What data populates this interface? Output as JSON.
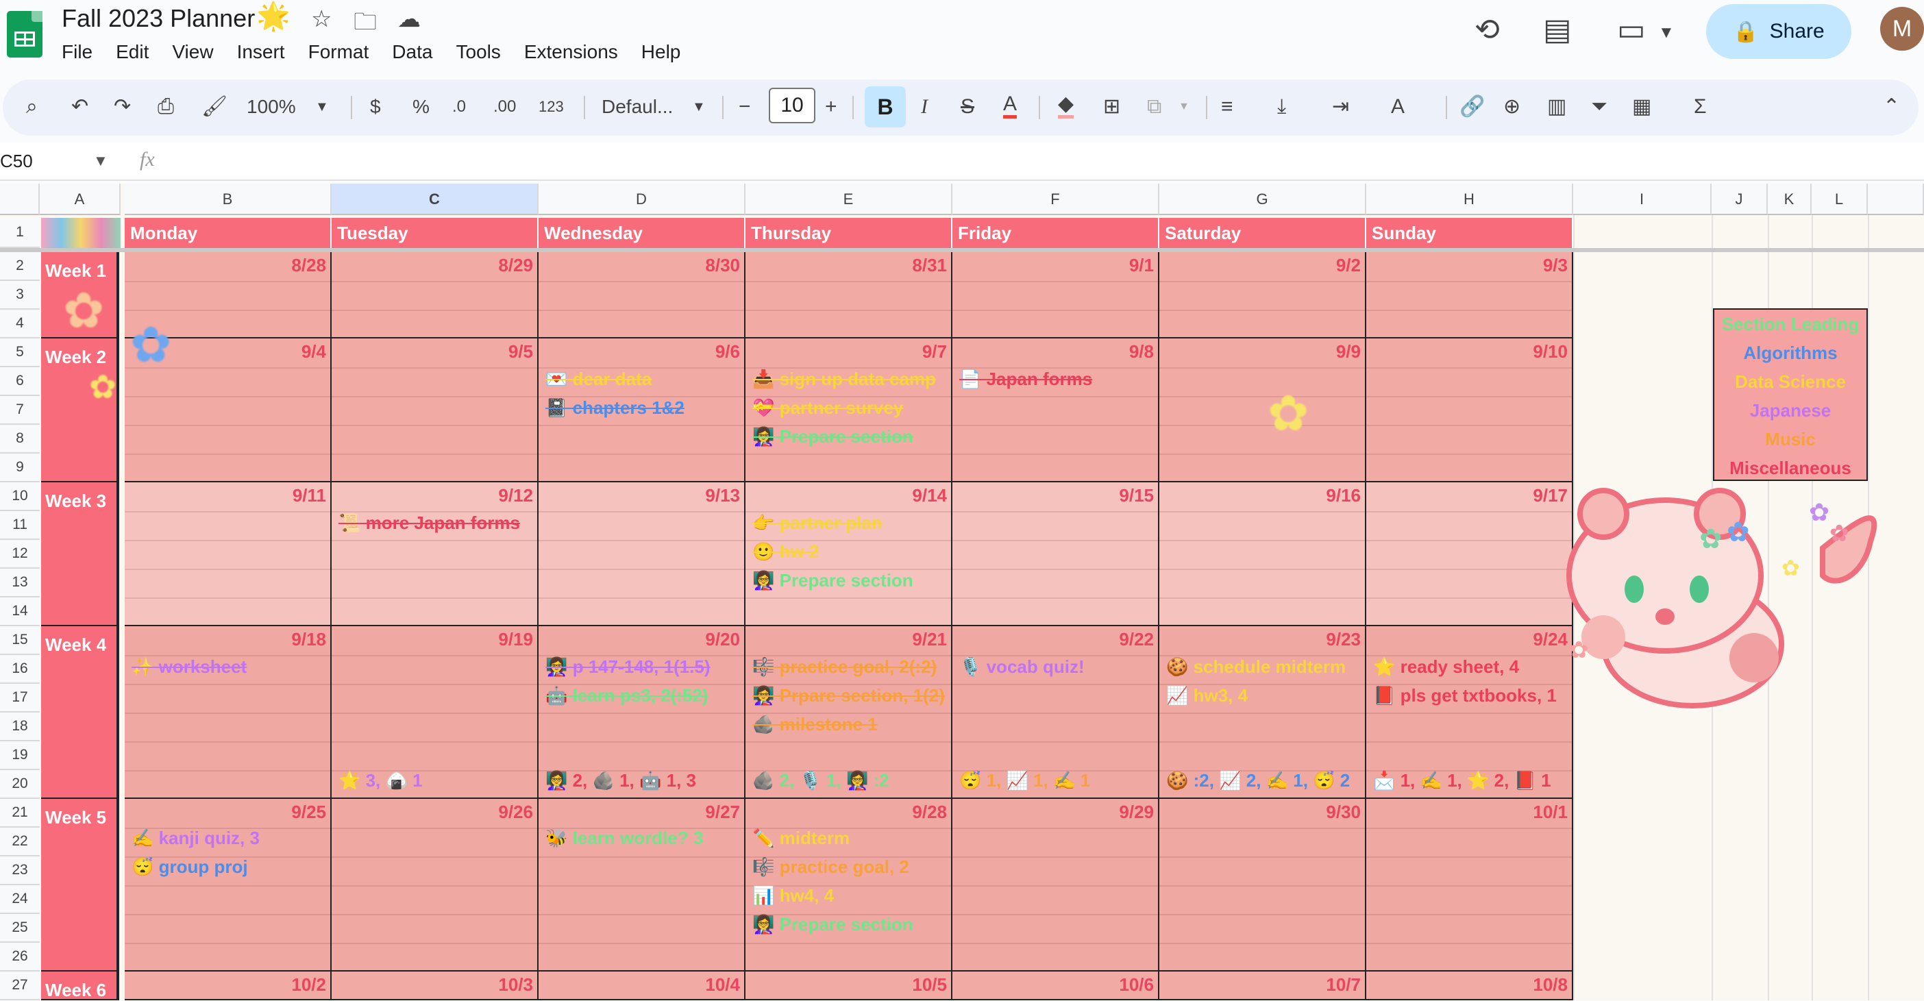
{
  "header": {
    "title": "Fall 2023 Planner",
    "title_emoji": "🌟",
    "menu": [
      "File",
      "Edit",
      "View",
      "Insert",
      "Format",
      "Data",
      "Tools",
      "Extensions",
      "Help"
    ],
    "share_label": "Share",
    "avatar_initial": "M"
  },
  "toolbar": {
    "zoom": "100%",
    "currency": "$",
    "percent": "%",
    "dec_less": ".0",
    "dec_more": ".00",
    "number_format": "123",
    "font": "Defaul...",
    "font_size": "10",
    "bold": "B",
    "italic": "I"
  },
  "formula_bar": {
    "cell_ref": "C50",
    "fx": "fx"
  },
  "columns": [
    "A",
    "B",
    "C",
    "D",
    "E",
    "F",
    "G",
    "H",
    "I",
    "J",
    "K",
    "L"
  ],
  "rows": [
    "1",
    "2",
    "3",
    "4",
    "5",
    "6",
    "7",
    "8",
    "9",
    "10",
    "11",
    "12",
    "13",
    "14",
    "15",
    "16",
    "17",
    "18",
    "19",
    "20",
    "21",
    "22",
    "23",
    "24",
    "25",
    "26",
    "27"
  ],
  "days": [
    "Monday",
    "Tuesday",
    "Wednesday",
    "Thursday",
    "Friday",
    "Saturday",
    "Sunday"
  ],
  "weeks": [
    {
      "label": "Week 1",
      "dates": [
        "8/28",
        "8/29",
        "8/30",
        "8/31",
        "9/1",
        "9/2",
        "9/3"
      ]
    },
    {
      "label": "Week 2",
      "dates": [
        "9/4",
        "9/5",
        "9/6",
        "9/7",
        "9/8",
        "9/9",
        "9/10"
      ]
    },
    {
      "label": "Week 3",
      "dates": [
        "9/11",
        "9/12",
        "9/13",
        "9/14",
        "9/15",
        "9/16",
        "9/17"
      ]
    },
    {
      "label": "Week 4",
      "dates": [
        "9/18",
        "9/19",
        "9/20",
        "9/21",
        "9/22",
        "9/23",
        "9/24"
      ]
    },
    {
      "label": "Week 5",
      "dates": [
        "9/25",
        "9/26",
        "9/27",
        "9/28",
        "9/29",
        "9/30",
        "10/1"
      ]
    },
    {
      "label": "Week 6",
      "dates": [
        "10/2",
        "10/3",
        "10/4",
        "10/5",
        "10/6",
        "10/7",
        "10/8"
      ]
    }
  ],
  "tasks": {
    "w2_wed_1": "💌 dear data",
    "w2_wed_2": "📓 chapters 1&2",
    "w2_thu_1": "📥 sign up data camp",
    "w2_thu_2": "💝 partner survey",
    "w2_thu_3": "👩‍🏫 Prepare section",
    "w2_fri_1": "📄 Japan forms",
    "w3_tue_1": "📜 more Japan forms",
    "w3_thu_1": "👉 partner plan",
    "w3_thu_2": "🙂 hw 2",
    "w3_thu_3": "👩‍🏫 Prepare section",
    "w4_mon_1": "✨ worksheet",
    "w4_wed_1": "👩‍🏫 p 147-148, 1(1.5)",
    "w4_wed_2": "🤖 learn ps3, 2(:52)",
    "w4_thu_1": "🎼 practice goal, 2(:2)",
    "w4_thu_2": "👩‍🏫 Prpare section, 1(2)",
    "w4_thu_3": "🪨 milestone 1",
    "w4_fri_1": "🎙️ vocab quiz!",
    "w4_sat_1": "🍪 schedule midterm",
    "w4_sat_2": "📈 hw3, 4",
    "w4_sun_1": "🌟 ready sheet, 4",
    "w4_sun_2": "📕 pls get txtbooks, 1",
    "w4_tue_sum": "🌟 3, 🍙 1",
    "w4_wed_sum": "👩‍🏫 2, 🪨 1, 🤖 1, 3",
    "w4_thu_sum": "🪨 2, 🎙️ 1, 👩‍🏫 :2",
    "w4_fri_sum": "😴 1, 📈 1, ✍️ 1",
    "w4_sat_sum": "🍪 :2, 📈 2, ✍️ 1, 😴 2",
    "w4_sun_sum": "📩 1, ✍️ 1, 🌟 2, 📕 1",
    "w5_mon_1": "✍️ kanji quiz, 3",
    "w5_mon_2": "😴 group proj",
    "w5_wed_1": "🐝 learn wordle? 3",
    "w5_thu_1": "✏️ midterm",
    "w5_thu_2": "🎼 practice goal, 2",
    "w5_thu_3": "📊 hw4, 4",
    "w5_thu_4": "👩‍🏫 Prepare section"
  },
  "legend": [
    "Section Leading",
    "Algorithms",
    "Data Science",
    "Japanese",
    "Music",
    "Miscellaneous"
  ],
  "colors": {
    "day_header": "#f76b7a",
    "cell_fill": "#f2aaa5",
    "green": "#6ee78b",
    "blue": "#4a8dea",
    "yellow": "#f7d53b",
    "purple": "#c074f2",
    "orange": "#f7a13b",
    "red": "#ea3e5a"
  }
}
